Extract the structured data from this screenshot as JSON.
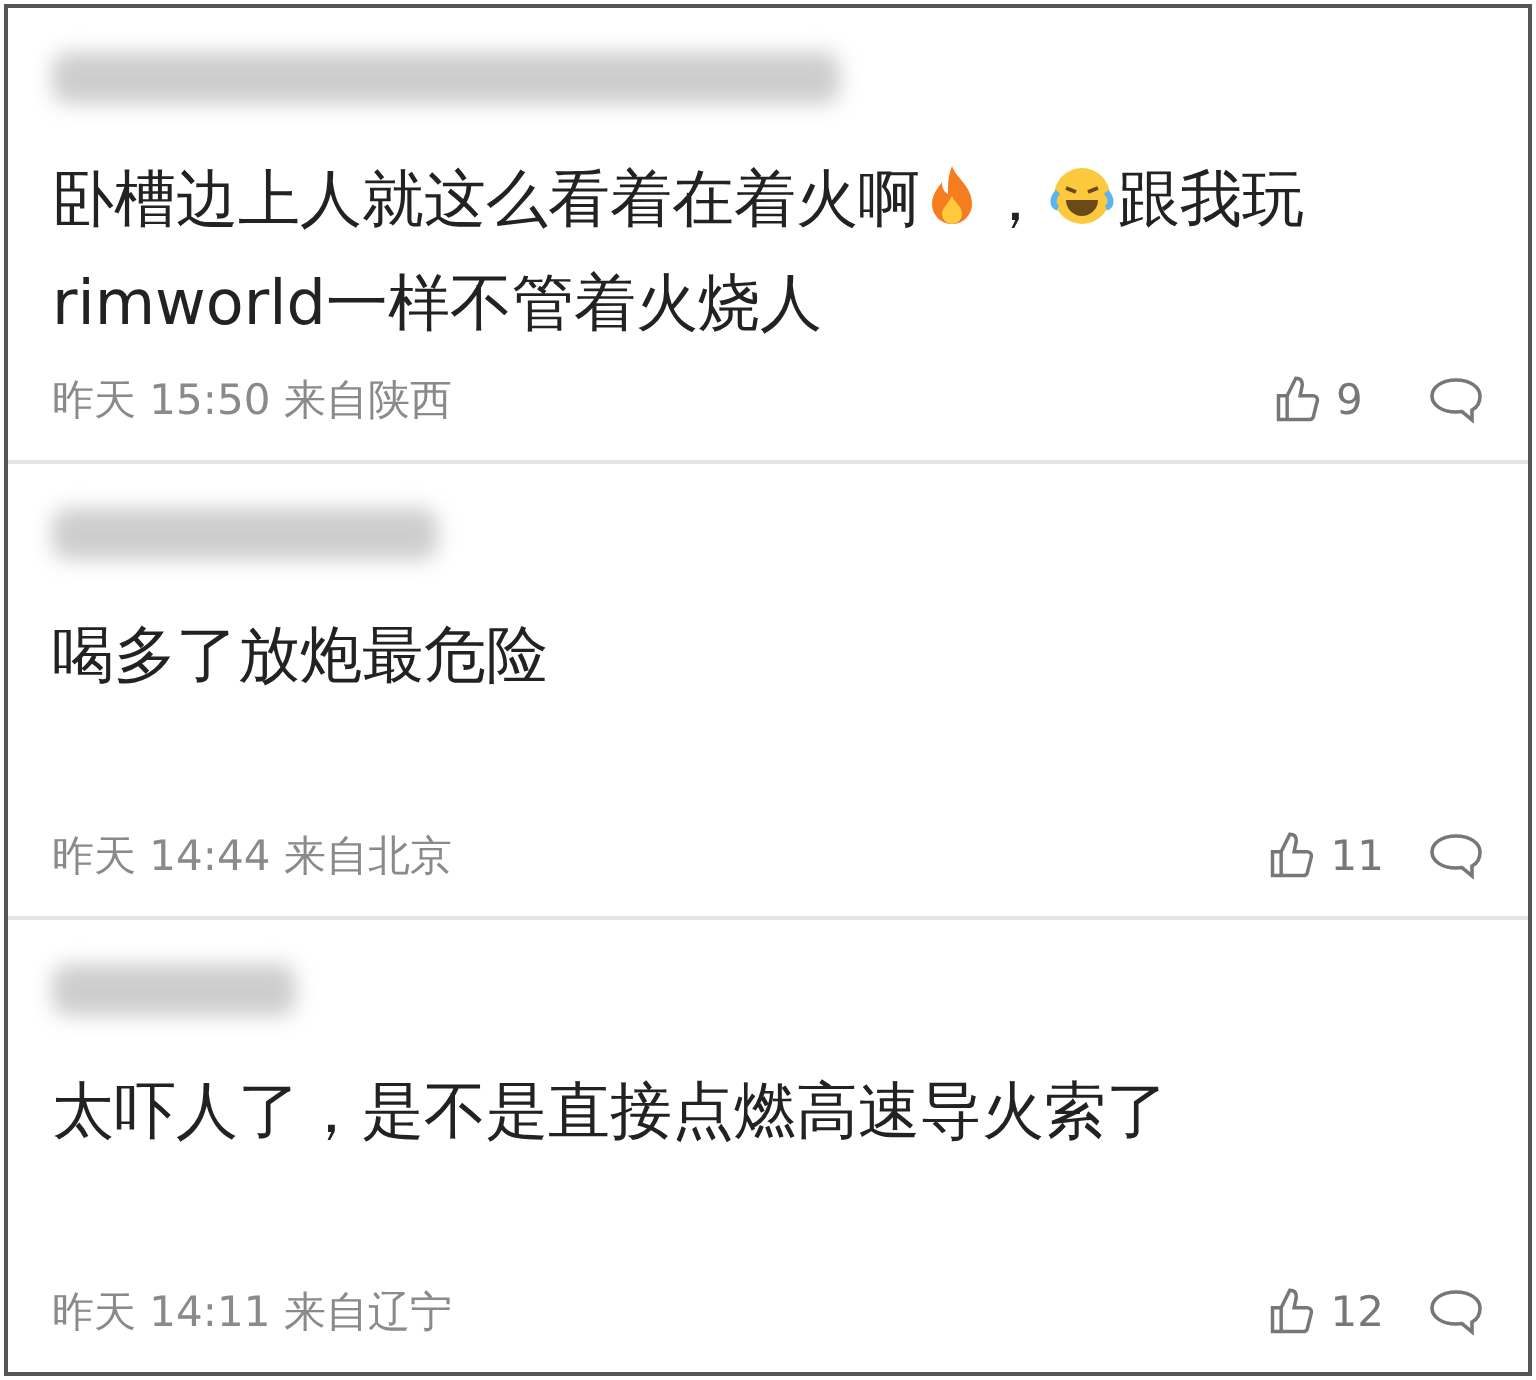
{
  "comments": [
    {
      "content": [
        {
          "kind": "text",
          "text": "卧槽边上人就这么看着在着火啊"
        },
        {
          "kind": "fire"
        },
        {
          "kind": "text",
          "text": "，"
        },
        {
          "kind": "laugh"
        },
        {
          "kind": "text",
          "text": "跟我玩"
        },
        {
          "kind": "text",
          "text": "rimworld一样不管着火烧人"
        }
      ],
      "time": "昨天 15:50 来自陕西",
      "likes": "9"
    },
    {
      "content": [
        {
          "kind": "text",
          "text": "喝多了放炮最危险"
        }
      ],
      "time": "昨天 14:44 来自北京",
      "likes": "11"
    },
    {
      "content": [
        {
          "kind": "text",
          "text": "太吓人了，是不是直接点燃高速导火索了"
        }
      ],
      "time": "昨天 14:11 来自辽宁",
      "likes": "12"
    }
  ]
}
